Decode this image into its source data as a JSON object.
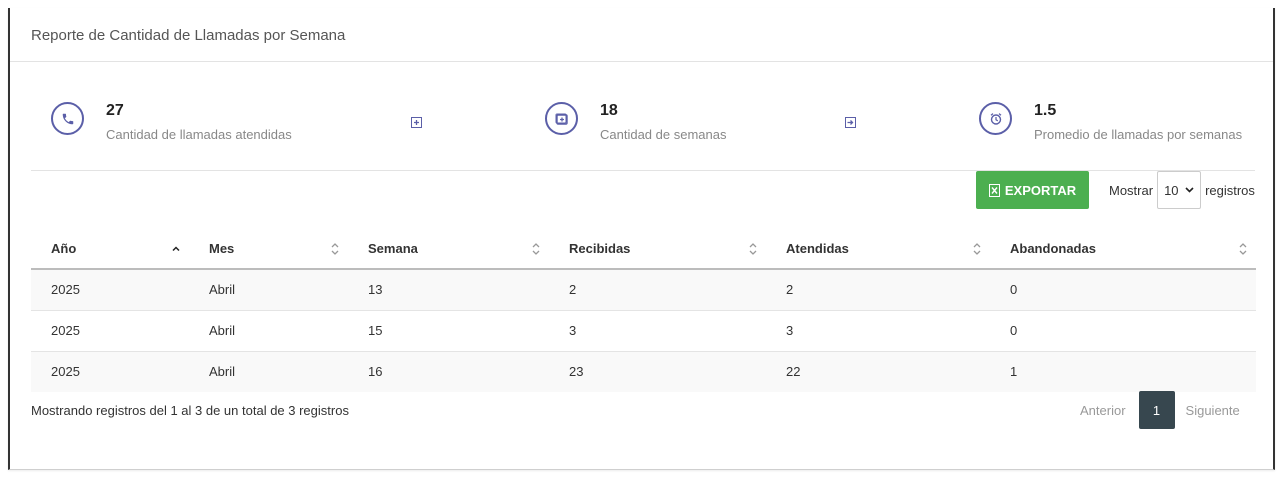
{
  "header": {
    "title": "Reporte de Cantidad de Llamadas por Semana"
  },
  "stats": [
    {
      "value": "27",
      "label": "Cantidad de llamadas atendidas",
      "icon": "phone-icon"
    },
    {
      "value": "18",
      "label": "Cantidad de semanas",
      "icon": "calendar-icon"
    },
    {
      "value": "1.5",
      "label": "Promedio de llamadas por semanas",
      "icon": "alarm-clock-icon"
    }
  ],
  "toolbar": {
    "export_label": "EXPORTAR",
    "show_label": "Mostrar",
    "page_length": "10",
    "records_label": "registros"
  },
  "table": {
    "columns": [
      "Año",
      "Mes",
      "Semana",
      "Recibidas",
      "Atendidas",
      "Abandonadas"
    ],
    "rows": [
      [
        "2025",
        "Abril",
        "13",
        "2",
        "2",
        "0"
      ],
      [
        "2025",
        "Abril",
        "15",
        "3",
        "3",
        "0"
      ],
      [
        "2025",
        "Abril",
        "16",
        "23",
        "22",
        "1"
      ]
    ]
  },
  "footer": {
    "info": "Mostrando registros del 1 al 3 de un total de 3 registros",
    "previous": "Anterior",
    "current_page": "1",
    "next": "Siguiente"
  },
  "colors": {
    "accent": "#5b5fa8",
    "export": "#4caf50",
    "page_active": "#37474f"
  }
}
